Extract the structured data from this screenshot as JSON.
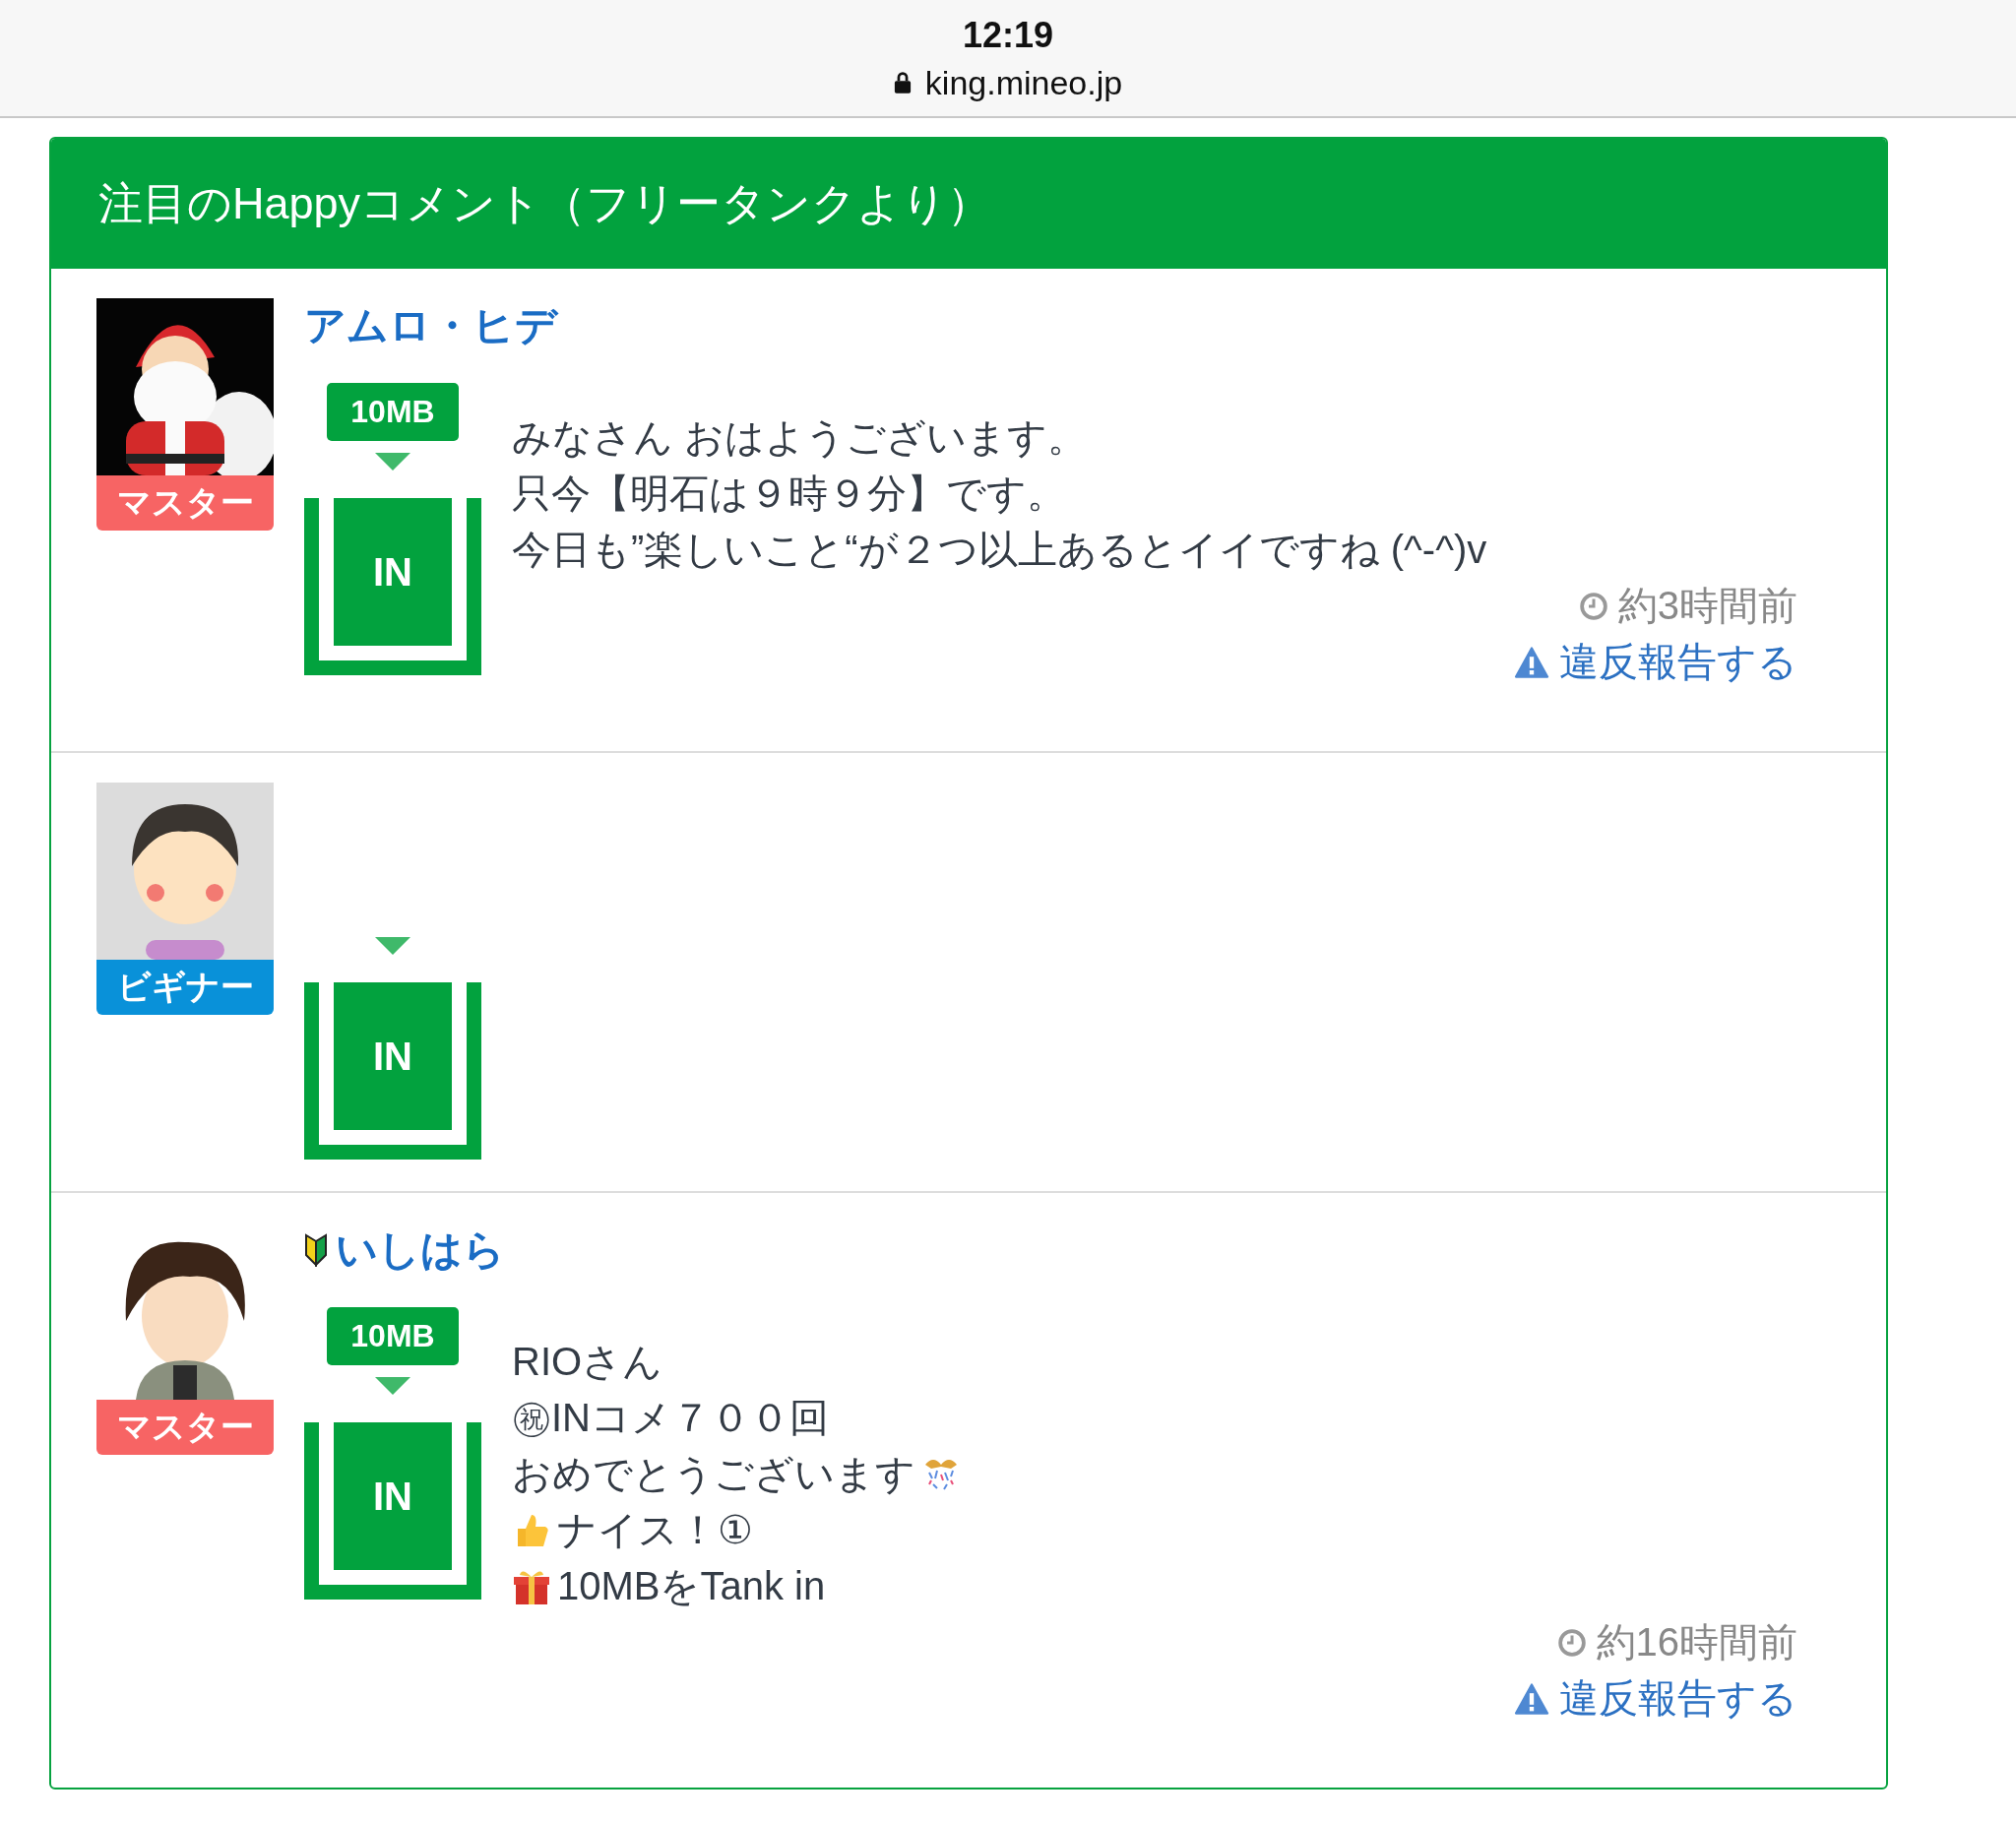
{
  "status_bar": {
    "time": "12:19",
    "url": "king.mineo.jp"
  },
  "panel": {
    "title": "注目のHappyコメント（フリータンクより）",
    "comments": [
      {
        "name": "アムロ・ヒデ",
        "beginner_mark": false,
        "role": {
          "label": "マスター",
          "color": "#f76464"
        },
        "amount": "10MB",
        "tank": "IN",
        "lines": [
          {
            "text": "みなさん おはようございます。",
            "kind": "plain"
          },
          {
            "text": "只今【明石は９時９分】です。",
            "kind": "plain"
          },
          {
            "text": "今日も”楽しいこと“が２つ以上あるとイイですね (^-^)v",
            "kind": "plain"
          }
        ],
        "time": "約3時間前",
        "report": "違反報告する"
      },
      {
        "role": {
          "label": "ビギナー",
          "color": "#0991d9"
        },
        "tank": "IN"
      },
      {
        "name": "いしはら",
        "beginner_mark": true,
        "role": {
          "label": "マスター",
          "color": "#f76464"
        },
        "amount": "10MB",
        "tank": "IN",
        "lines": [
          {
            "text": "RIOさん",
            "kind": "plain"
          },
          {
            "text": "㊗INコメ７００回",
            "kind": "plain"
          },
          {
            "text": "おめでとうございます",
            "kind": "celebrate"
          },
          {
            "text": "ナイス！①",
            "kind": "like"
          },
          {
            "text": "10MBをTank in",
            "kind": "gift"
          }
        ],
        "time": "約16時間前",
        "report": "違反報告する"
      }
    ]
  }
}
